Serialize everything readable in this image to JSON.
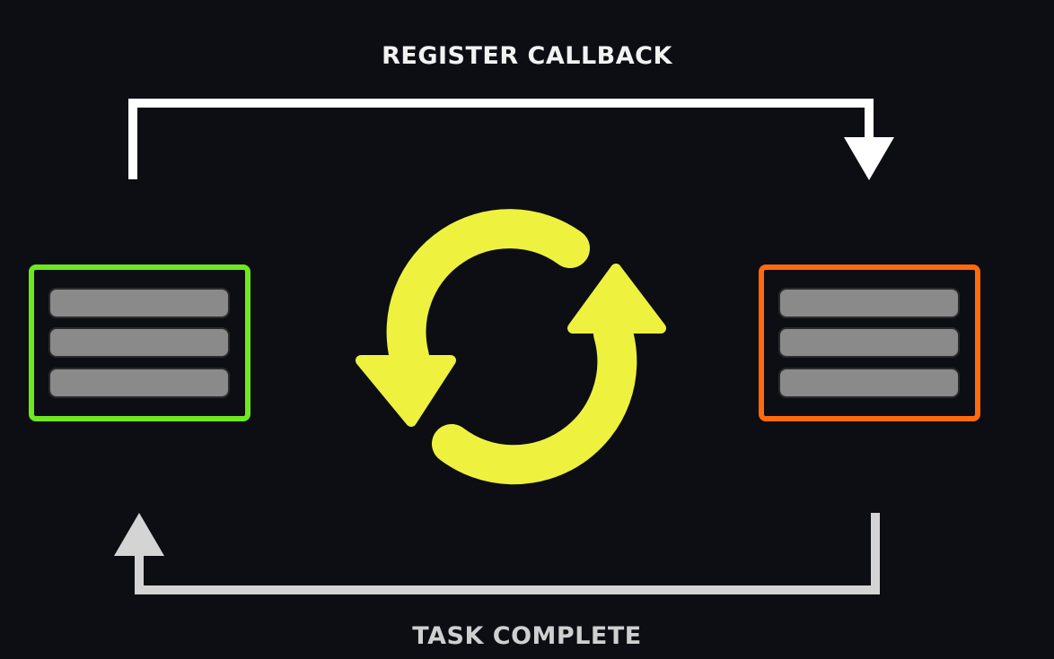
{
  "labels": {
    "top": "REGISTER CALLBACK",
    "bottom": "TASK COMPLETE"
  },
  "colors": {
    "background": "#0d0e14",
    "left_box_border": "#6ee81f",
    "right_box_border": "#ff6a0d",
    "row_fill": "#8a8a8a",
    "top_arrow": "#ffffff",
    "bottom_arrow": "#d4d4d4",
    "cycle_icon": "#eef23f"
  },
  "boxes": {
    "left": {
      "rows": 3
    },
    "right": {
      "rows": 3
    }
  }
}
